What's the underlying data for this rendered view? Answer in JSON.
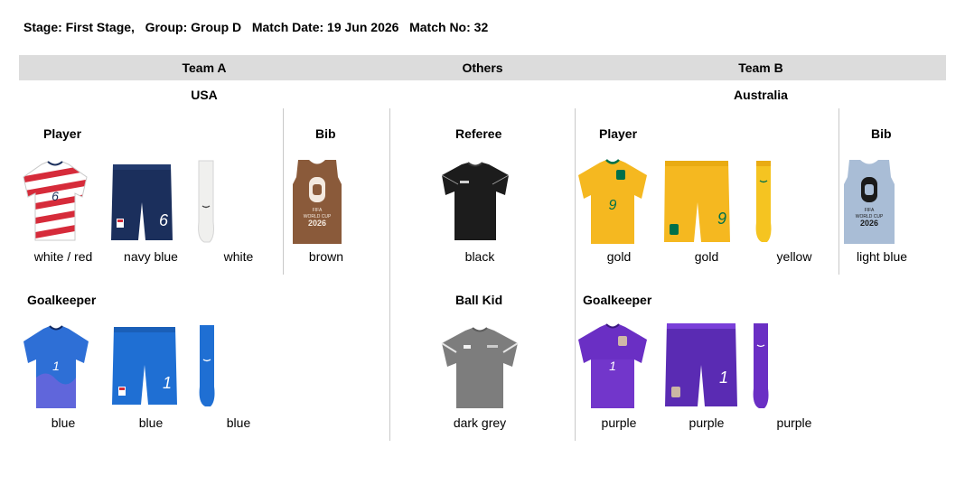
{
  "header": {
    "stage": "Stage: First Stage,",
    "group": "Group: Group D",
    "date": "Match Date: 19 Jun 2026",
    "match_no": "Match No: 32"
  },
  "columns": {
    "team_a": "Team A",
    "others": "Others",
    "team_b": "Team B"
  },
  "team_a": {
    "country": "USA",
    "player_label": "Player",
    "bib_label": "Bib",
    "goalkeeper_label": "Goalkeeper",
    "player": {
      "shirt": "white / red",
      "shorts": "navy blue",
      "socks": "white",
      "shirt_number": "6",
      "shorts_number": "6"
    },
    "bib": {
      "color": "brown"
    },
    "goalkeeper": {
      "shirt": "blue",
      "shorts": "blue",
      "socks": "blue",
      "shirt_number": "1",
      "shorts_number": "1"
    }
  },
  "others": {
    "referee_label": "Referee",
    "ball_kid_label": "Ball Kid",
    "referee": {
      "shirt": "black"
    },
    "ball_kid": {
      "shirt": "dark grey"
    }
  },
  "team_b": {
    "country": "Australia",
    "player_label": "Player",
    "bib_label": "Bib",
    "goalkeeper_label": "Goalkeeper",
    "player": {
      "shirt": "gold",
      "shorts": "gold",
      "socks": "yellow",
      "shirt_number": "9",
      "shorts_number": "9"
    },
    "bib": {
      "color": "light blue"
    },
    "goalkeeper": {
      "shirt": "purple",
      "shorts": "purple",
      "socks": "purple",
      "shirt_number": "1",
      "shorts_number": "1"
    }
  },
  "bib_logo": {
    "line1": "FIFA",
    "line2": "WORLD CUP",
    "line3": "2026"
  },
  "colors": {
    "band": "#dcdcdc",
    "usa_home_red": "#d62b3a",
    "usa_navy": "#1b2f5c",
    "usa_gk_blue": "#2e6fd6",
    "bib_brown": "#8a5a3a",
    "referee_black": "#1c1c1c",
    "ballkid_grey": "#7d7d7d",
    "aus_gold": "#f5b820",
    "aus_green": "#00704a",
    "aus_gk_purple": "#6a2fc4",
    "bib_light_blue": "#a9bdd6"
  }
}
